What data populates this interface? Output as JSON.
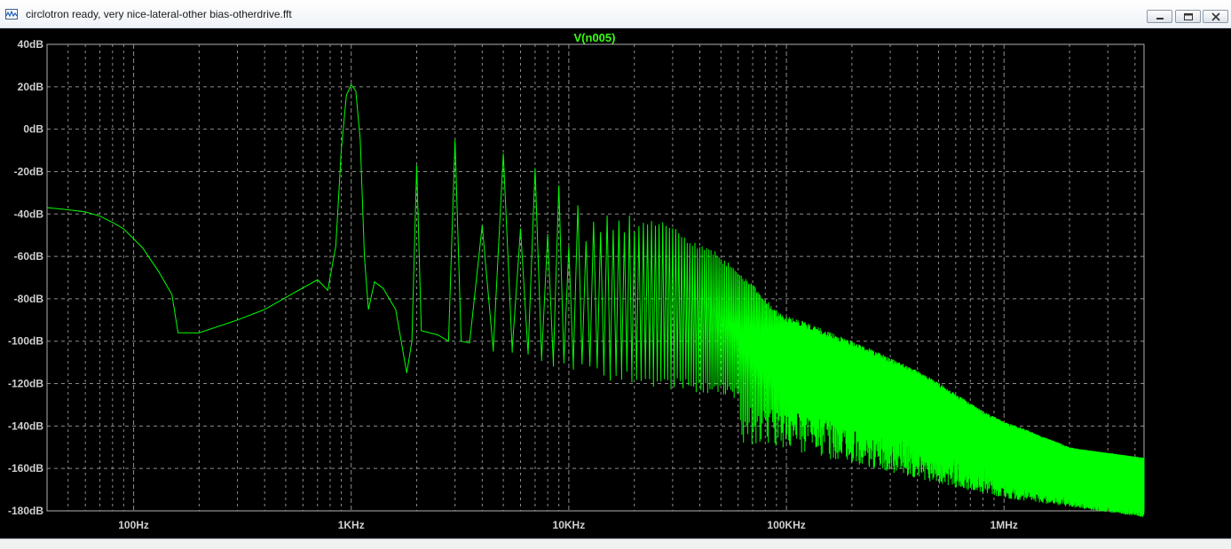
{
  "window": {
    "title": "circlotron ready, very nice-lateral-other bias-otherdrive.fft"
  },
  "icons": {
    "app": "waveform-icon",
    "minimize": "minimize-icon",
    "restore": "restore-icon",
    "close": "close-icon"
  },
  "colors": {
    "trace": "#00ff00",
    "background": "#000000",
    "grid": "#8c8c8c",
    "label": "#d0d0d0",
    "title": "#39ff14"
  },
  "chart_data": {
    "type": "line",
    "title": "V(n005)",
    "xlabel": "",
    "ylabel": "",
    "x_scale": "log",
    "xlim": [
      40,
      4400000
    ],
    "ylim": [
      -180,
      40
    ],
    "grid": true,
    "x_ticks": [
      {
        "value": 100,
        "label": "100Hz"
      },
      {
        "value": 1000,
        "label": "1KHz"
      },
      {
        "value": 10000,
        "label": "10KHz"
      },
      {
        "value": 100000,
        "label": "100KHz"
      },
      {
        "value": 1000000,
        "label": "1MHz"
      }
    ],
    "y_ticks": [
      {
        "value": 40,
        "label": "40dB"
      },
      {
        "value": 20,
        "label": "20dB"
      },
      {
        "value": 0,
        "label": "0dB"
      },
      {
        "value": -20,
        "label": "-20dB"
      },
      {
        "value": -40,
        "label": "-40dB"
      },
      {
        "value": -60,
        "label": "-60dB"
      },
      {
        "value": -80,
        "label": "-80dB"
      },
      {
        "value": -100,
        "label": "-100dB"
      },
      {
        "value": -120,
        "label": "-120dB"
      },
      {
        "value": -140,
        "label": "-140dB"
      },
      {
        "value": -160,
        "label": "-160dB"
      },
      {
        "value": -180,
        "label": "-180dB"
      }
    ],
    "series": [
      {
        "color": "#00ff00",
        "fundamental_hz": 1000,
        "fundamental_db": 21,
        "points": [
          [
            40,
            -37
          ],
          [
            50,
            -38
          ],
          [
            60,
            -39
          ],
          [
            70,
            -41
          ],
          [
            80,
            -44
          ],
          [
            90,
            -47
          ],
          [
            110,
            -56
          ],
          [
            130,
            -67
          ],
          [
            150,
            -78
          ],
          [
            160,
            -96
          ],
          [
            200,
            -96
          ],
          [
            300,
            -90
          ],
          [
            400,
            -85
          ],
          [
            550,
            -77
          ],
          [
            700,
            -71
          ],
          [
            780,
            -76
          ],
          [
            850,
            -55
          ],
          [
            900,
            -10
          ],
          [
            950,
            16
          ],
          [
            1000,
            21
          ],
          [
            1050,
            18
          ],
          [
            1100,
            -5
          ],
          [
            1150,
            -60
          ],
          [
            1200,
            -85
          ],
          [
            1280,
            -72
          ],
          [
            1400,
            -75
          ],
          [
            1600,
            -85
          ],
          [
            1800,
            -115
          ],
          [
            1900,
            -100
          ],
          [
            2000,
            -17
          ],
          [
            2100,
            -95
          ],
          [
            2500,
            -97
          ],
          [
            2800,
            -100
          ],
          [
            3000,
            -5
          ],
          [
            3200,
            -100
          ],
          [
            10000,
            -110
          ],
          [
            100000,
            -125
          ],
          [
            1000000,
            -148
          ],
          [
            4400000,
            -157
          ]
        ],
        "harmonics_db": [
          [
            2,
            -17
          ],
          [
            3,
            -5
          ],
          [
            4,
            -45
          ],
          [
            5,
            -10
          ],
          [
            6,
            -45
          ],
          [
            7,
            -16
          ],
          [
            8,
            -48
          ],
          [
            9,
            -26
          ],
          [
            10,
            -55
          ],
          [
            11,
            -33
          ],
          [
            12,
            -50
          ],
          [
            13,
            -42
          ],
          [
            14,
            -48
          ],
          [
            15,
            -40
          ],
          [
            16,
            -47
          ],
          [
            17,
            -42
          ],
          [
            18,
            -48
          ],
          [
            19,
            -40
          ],
          [
            20,
            -46
          ],
          [
            22,
            -44
          ],
          [
            24,
            -42
          ],
          [
            26,
            -44
          ],
          [
            28,
            -43
          ],
          [
            30,
            -45
          ],
          [
            33,
            -48
          ],
          [
            36,
            -52
          ],
          [
            40,
            -55
          ],
          [
            45,
            -56
          ],
          [
            50,
            -60
          ],
          [
            60,
            -66
          ],
          [
            70,
            -73
          ],
          [
            80,
            -80
          ],
          [
            90,
            -85
          ],
          [
            100,
            -88
          ],
          [
            130,
            -92
          ],
          [
            160,
            -96
          ],
          [
            200,
            -100
          ],
          [
            300,
            -108
          ],
          [
            400,
            -114
          ],
          [
            600,
            -125
          ],
          [
            800,
            -133
          ],
          [
            1000,
            -138
          ],
          [
            1500,
            -145
          ],
          [
            2000,
            -150
          ],
          [
            3000,
            -154
          ],
          [
            4000,
            -156
          ]
        ]
      }
    ]
  }
}
